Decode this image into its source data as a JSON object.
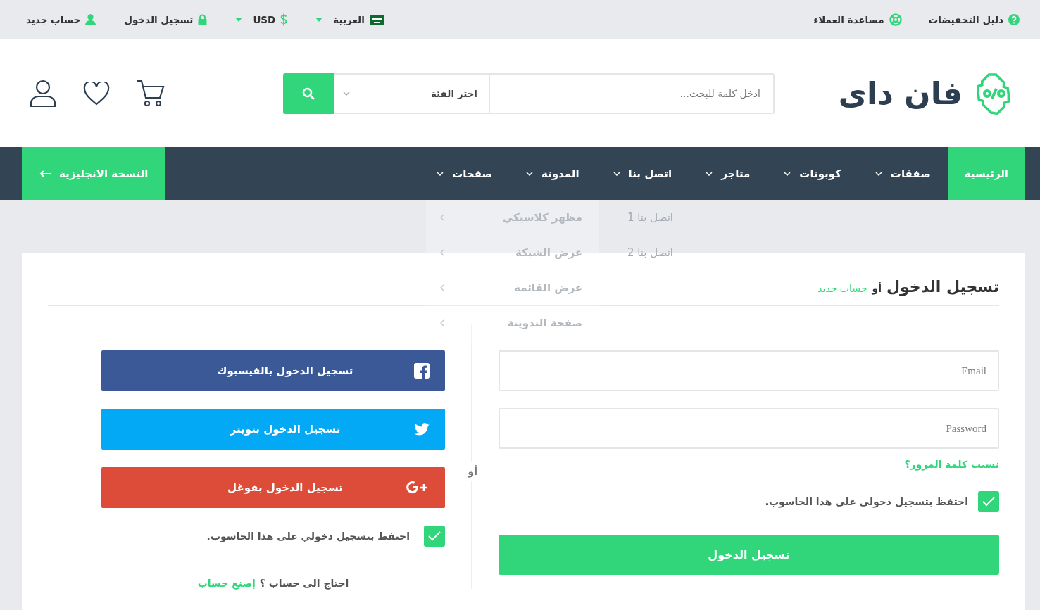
{
  "top_bar": {
    "help_links": [
      {
        "kind": "help",
        "label": "دليل التخفيضات"
      },
      {
        "kind": "support",
        "label": "مساعدة العملاء"
      }
    ],
    "account_links": [
      {
        "kind": "language",
        "label": "العربية",
        "dropdown": true
      },
      {
        "kind": "currency",
        "label": "USD",
        "dropdown": true
      },
      {
        "kind": "login",
        "label": "تسجيل الدخول",
        "dropdown": false
      },
      {
        "kind": "register",
        "label": "حساب جديد",
        "dropdown": false
      }
    ]
  },
  "header": {
    "logo_text": "فان داى",
    "search": {
      "placeholder": "ادخل كلمة للبحث...",
      "category": "احتر الفئة"
    }
  },
  "nav": {
    "items": [
      {
        "label": "الرئيسية",
        "selected": true,
        "dropdown": false
      },
      {
        "label": "صفقات",
        "selected": false,
        "dropdown": true
      },
      {
        "label": "كوبونات",
        "selected": false,
        "dropdown": true
      },
      {
        "label": "متاجر",
        "selected": false,
        "dropdown": true
      },
      {
        "label": "اتصل بنا",
        "selected": false,
        "dropdown": true
      },
      {
        "label": "المدونة",
        "selected": false,
        "dropdown": true
      },
      {
        "label": "صفحات",
        "selected": false,
        "dropdown": true
      }
    ],
    "english_version": "النسخة الانجليزية"
  },
  "dropdown_menu": {
    "items": [
      "مظهر كلاسيكي",
      "عرض الشبكة",
      "عرض القائمة",
      "صفحة التدوينة"
    ],
    "submenu_items": [
      "اتصل بنا 1",
      "اتصل بنا 2"
    ]
  },
  "login_card": {
    "title": "تسجيل الدخول",
    "or_text": "أو",
    "register_link": "حساب جديد",
    "form": {
      "email_placeholder": "Email",
      "password_placeholder": "Password",
      "forgot_link": "نسيت كلمة المرور؟",
      "remember": {
        "label": "احتفظ بتسجيل دخولي على هذا الحاسوب.",
        "checked": true
      },
      "submit": "تسجيل الدخول"
    },
    "divider_text": "أو",
    "social": {
      "buttons": [
        {
          "kind": "facebook",
          "label": "تسجيل الدخول بالفيسبوك"
        },
        {
          "kind": "twitter",
          "label": "تسجيل الدخول بتويتر"
        },
        {
          "kind": "google",
          "label": "تسجيل الدخول بفوغل"
        }
      ],
      "remember": {
        "label": "احتفظ بتسجيل دخولي على هذا الحاسوب.",
        "checked": true
      },
      "signup_text": "احتاج الى حساب ؟",
      "signup_link": "إصنع حساب"
    }
  }
}
